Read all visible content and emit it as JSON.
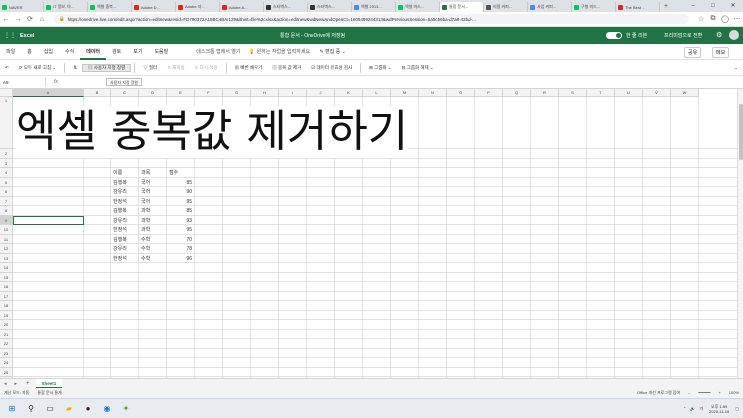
{
  "browser": {
    "tabs": [
      {
        "label": "NAVER",
        "color": "#03c75a",
        "active": false
      },
      {
        "label": "IT 정보, 아...",
        "color": "#03c75a",
        "active": false
      },
      {
        "label": "엑셀 중복...",
        "color": "#03c75a",
        "active": false
      },
      {
        "label": "Adobe D...",
        "color": "#e1251b",
        "active": false
      },
      {
        "label": "Adobe 자...",
        "color": "#e1251b",
        "active": false
      },
      {
        "label": "Adobe A...",
        "color": "#e1251b",
        "active": false
      },
      {
        "label": "스타벅스...",
        "color": "#333333",
        "active": false
      },
      {
        "label": "스타벅스...",
        "color": "#333333",
        "active": false
      },
      {
        "label": "엑셀 2013...",
        "color": "#4a8cde",
        "active": false
      },
      {
        "label": "엑셀 마스...",
        "color": "#03c75a",
        "active": false
      },
      {
        "label": "통합 문서...",
        "color": "#217346",
        "active": true
      },
      {
        "label": "리얼 커피...",
        "color": "#555555",
        "active": false
      },
      {
        "label": "사업 커피...",
        "color": "#4a8cde",
        "active": false
      },
      {
        "label": "구형 미드...",
        "color": "#03c75a",
        "active": false
      },
      {
        "label": "The Best ...",
        "color": "#e1251b",
        "active": false
      }
    ],
    "new_tab": "+",
    "url": "https://onedrive.live.com/edit.aspx?action=editnew&resid=FD790372A15BC4BA!129&ithint=file%2cxlsx&action=editnew&wdNewAndOpenCt=1605499244313&wdPreviousSession=5a5c56ba-d7a8-42bd-..."
  },
  "excel": {
    "app_name": "Excel",
    "doc_title": "통합 문서 - OneDrive에 저장됨",
    "simple_ribbon": "한 줄 리본",
    "premium": "프리미엄으로 전환",
    "menu_tabs": [
      "파일",
      "홈",
      "삽입",
      "수식",
      "데이터",
      "검토",
      "보기",
      "도움말"
    ],
    "active_tab": "데이터",
    "open_desktop": "데스크톱 앱에서 열기",
    "tell_me": "원하는 작업을 입력하세요.",
    "edit_mode": "편집 중",
    "share": "공유",
    "memo": "메모",
    "ribbon": {
      "refresh_all": "모두 새로 고침",
      "custom_sort": "사용자 지정 정렬",
      "filter": "필터",
      "reapply": "재적용",
      "clear": "다시 적용",
      "flash_fill": "빠른 채우기",
      "remove_dup": "중복 값 제거",
      "data_validation": "데이터 유효성 검사",
      "group": "그룹화",
      "ungroup": "그룹화 해제"
    },
    "tooltip": "사용자 지정 정렬",
    "name_box": "A9",
    "fx": "fx",
    "columns": [
      "A",
      "B",
      "C",
      "D",
      "E",
      "F",
      "G",
      "H",
      "I",
      "J",
      "K",
      "L",
      "M",
      "N",
      "O",
      "P",
      "Q",
      "R",
      "S",
      "T",
      "U",
      "V",
      "W"
    ],
    "selected_column": "A",
    "rows": [
      "1",
      "2",
      "3",
      "4",
      "5",
      "6",
      "7",
      "8",
      "9",
      "10",
      "11",
      "12",
      "13",
      "14",
      "15",
      "16",
      "17",
      "18",
      "19",
      "20",
      "21",
      "22",
      "23",
      "24",
      "25",
      "26",
      "27",
      "28"
    ],
    "selected_row": "9",
    "big_title": "엑셀 중복값 제거하기",
    "table": {
      "headers": [
        "이름",
        "과목",
        "점수"
      ],
      "rows": [
        [
          "김행복",
          "국어",
          "85"
        ],
        [
          "강유리",
          "국어",
          "90"
        ],
        [
          "한정석",
          "국어",
          "95"
        ],
        [
          "김행복",
          "과학",
          "85"
        ],
        [
          "강유리",
          "과학",
          "93"
        ],
        [
          "한정석",
          "과학",
          "95"
        ],
        [
          "김행복",
          "수학",
          "70"
        ],
        [
          "강유리",
          "수학",
          "78"
        ],
        [
          "한정석",
          "수학",
          "96"
        ]
      ]
    },
    "sheet_tab": "Sheet1",
    "add_sheet": "+",
    "status": {
      "calc": "계산 모드: 자동",
      "stats": "통합 문서 통계",
      "feedback": "Office 개선 프로그램 참여",
      "zoom": "100%"
    }
  },
  "taskbar": {
    "time": "오후 1:59",
    "date": "2020-11-16",
    "lang": "가"
  }
}
